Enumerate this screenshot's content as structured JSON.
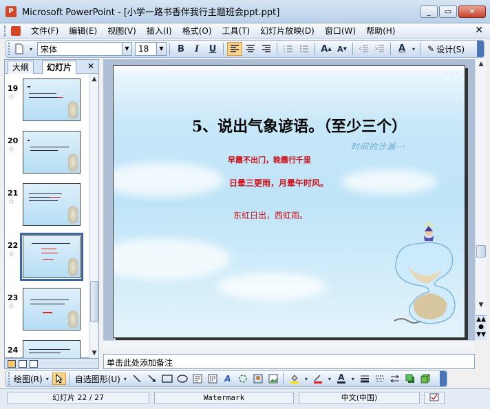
{
  "window": {
    "title": "Microsoft PowerPoint - [小学一路书香伴我行主题班会ppt.ppt]",
    "minimize": "_",
    "restore": "▭",
    "close": "✕",
    "app_icon_letter": "P"
  },
  "menu": {
    "items": [
      "文件(F)",
      "编辑(E)",
      "视图(V)",
      "插入(I)",
      "格式(O)",
      "工具(T)",
      "幻灯片放映(D)",
      "窗口(W)",
      "帮助(H)"
    ],
    "close_doc": "✕"
  },
  "format_toolbar": {
    "font": "宋体",
    "size": "18",
    "bold": "B",
    "italic": "I",
    "underline": "U",
    "design_label": "设计(S)",
    "active_align": "left"
  },
  "left_pane": {
    "tabs": [
      "大纲",
      "幻灯片"
    ],
    "close": "✕",
    "slides": [
      {
        "num": "19",
        "star": "☆"
      },
      {
        "num": "20",
        "star": "☆"
      },
      {
        "num": "21",
        "star": "☆"
      },
      {
        "num": "22",
        "star": "☆",
        "selected": true
      },
      {
        "num": "23",
        "star": "☆"
      },
      {
        "num": "24",
        "star": "☆"
      }
    ]
  },
  "slide": {
    "title": "5、说出气象谚语。（至少三个）",
    "line1": "早霞不出门，晚霞行千里",
    "line2": "日晕三更雨，月晕午时风。",
    "line3": "东虹日出，西虹雨。",
    "deco_text": "时间的沙漏···",
    "text_color": "#d0111b"
  },
  "notes": {
    "placeholder": "单击此处添加备注"
  },
  "draw_toolbar": {
    "draw_label": "绘图(R)",
    "autoshape_label": "自选图形(U)"
  },
  "status": {
    "slide_info": "幻灯片 22 / 27",
    "template": "Watermark",
    "language": "中文(中国)"
  },
  "colors": {
    "accent": "#3b63a8",
    "toolbar_active": "#fbd48a",
    "slide_red": "#d0111b"
  }
}
